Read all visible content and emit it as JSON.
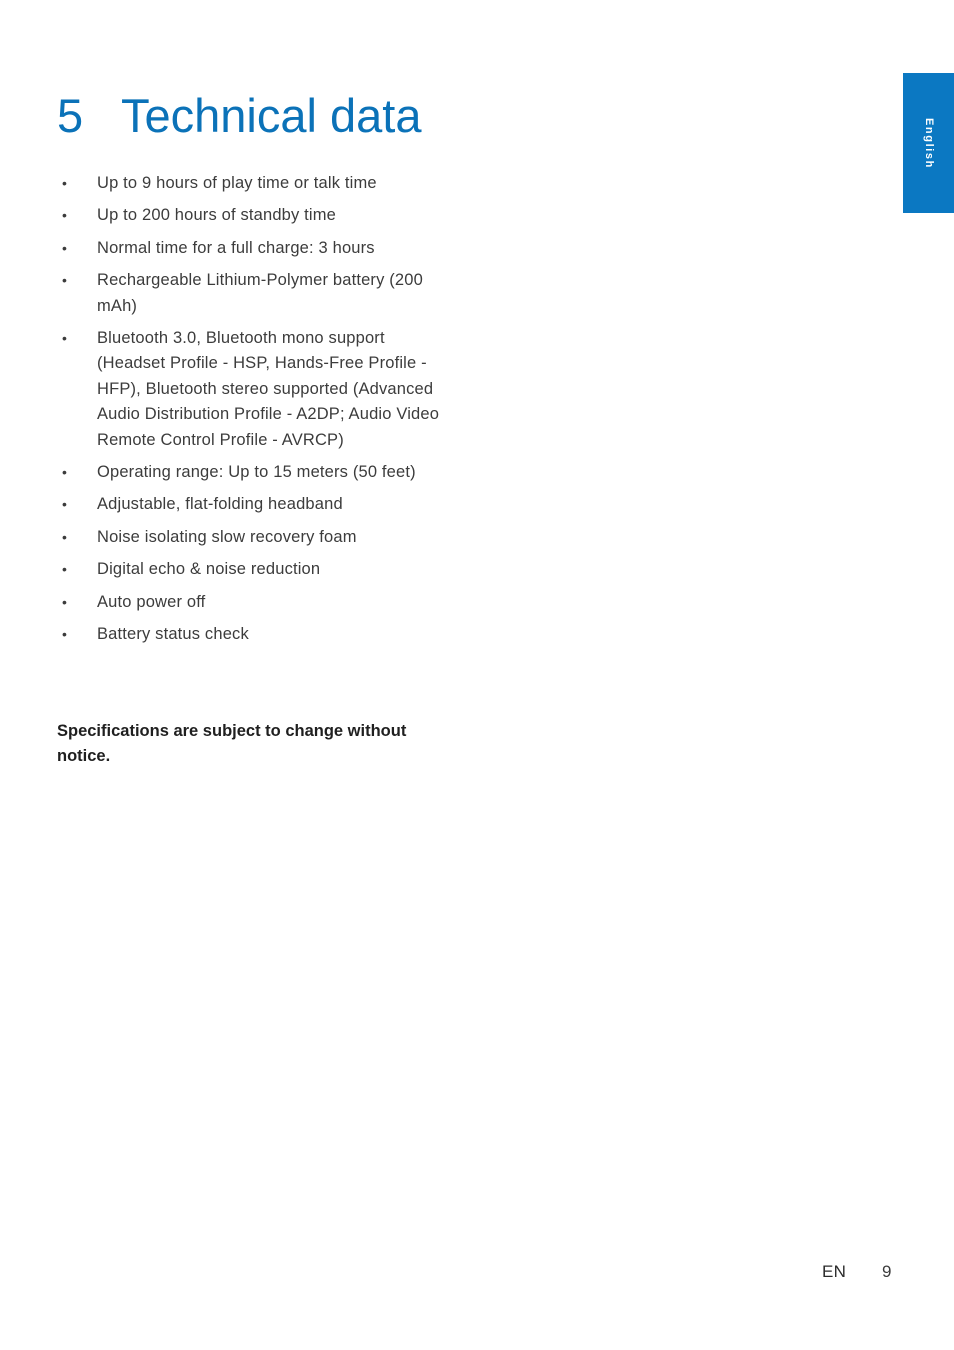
{
  "document": {
    "language_tab": "English",
    "accent_color": "#0b78c2",
    "title_color": "#0b72b8",
    "body_text_color": "#3c3c3c",
    "background_color": "#ffffff"
  },
  "chapter": {
    "number": "5",
    "title": "Technical data"
  },
  "specs": {
    "items": [
      "Up to 9 hours of play time or talk time",
      "Up to 200 hours of standby time",
      "Normal time for a full charge: 3 hours",
      "Rechargeable Lithium-Polymer battery (200 mAh)",
      "Bluetooth 3.0, Bluetooth mono support (Headset Profile - HSP, Hands-Free Profile - HFP), Bluetooth stereo supported (Advanced Audio Distribution Profile - A2DP; Audio Video Remote Control Profile - AVRCP)",
      "Operating range: Up to 15 meters (50 feet)",
      "Adjustable, flat-folding headband",
      "Noise isolating slow recovery foam",
      "Digital echo & noise reduction",
      "Auto power off",
      "Battery status check"
    ]
  },
  "footnote": "Specifications are subject to change without notice.",
  "footer": {
    "language_code": "EN",
    "page_number": "9"
  }
}
